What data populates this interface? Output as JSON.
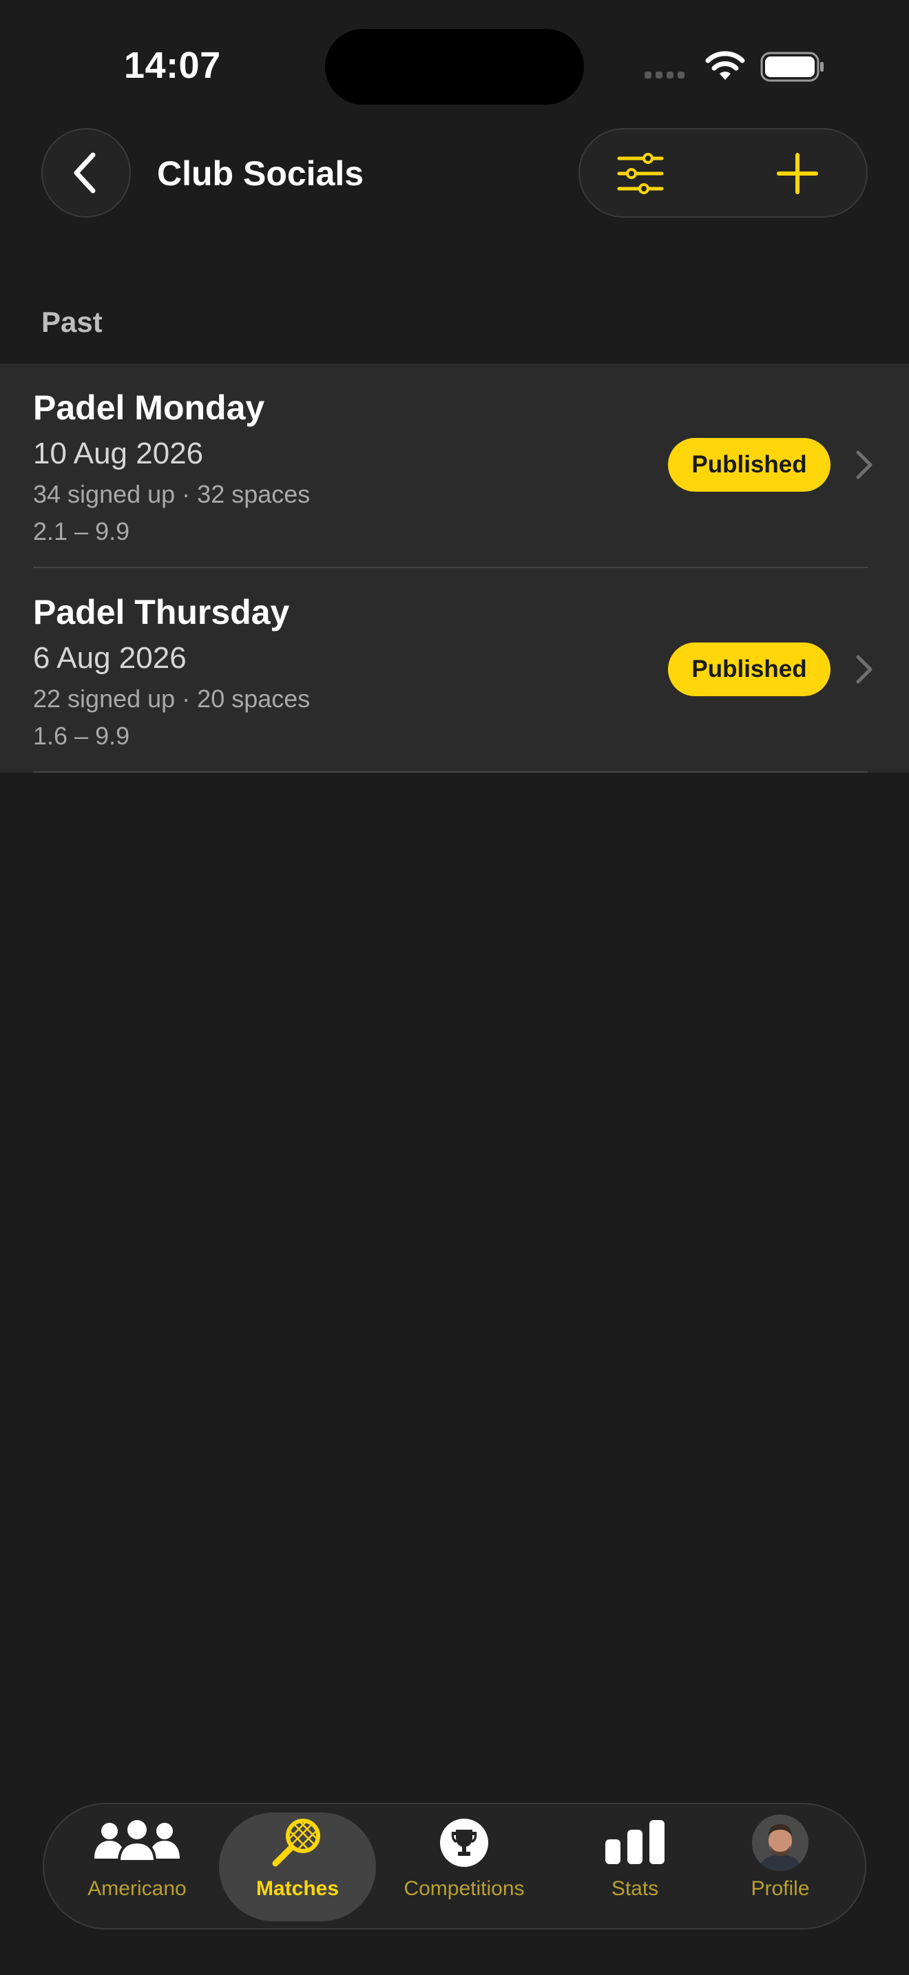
{
  "status_bar": {
    "time": "14:07"
  },
  "header": {
    "title": "Club Socials",
    "back_icon": "chevron-left-icon",
    "filter_icon": "sliders-icon",
    "add_icon": "plus-icon"
  },
  "section": {
    "title": "Past"
  },
  "matches": [
    {
      "title": "Padel Monday",
      "date": "10 Aug 2026",
      "signed": "34 signed up · 32 spaces",
      "range": "2.1 – 9.9",
      "status": "Published"
    },
    {
      "title": "Padel Thursday",
      "date": "6 Aug 2026",
      "signed": "22 signed up · 20 spaces",
      "range": "1.6 – 9.9",
      "status": "Published"
    }
  ],
  "tab_bar": {
    "active": "Matches",
    "tabs": [
      {
        "label": "Americano",
        "icon": "people-icon"
      },
      {
        "label": "Matches",
        "icon": "racket-icon"
      },
      {
        "label": "Competitions",
        "icon": "trophy-icon"
      },
      {
        "label": "Stats",
        "icon": "bar-chart-icon"
      },
      {
        "label": "Profile",
        "icon": "avatar"
      }
    ]
  },
  "colors": {
    "background": "#1c1c1c",
    "accent": "#ffd60a",
    "row_background": "#2b2b2b"
  }
}
